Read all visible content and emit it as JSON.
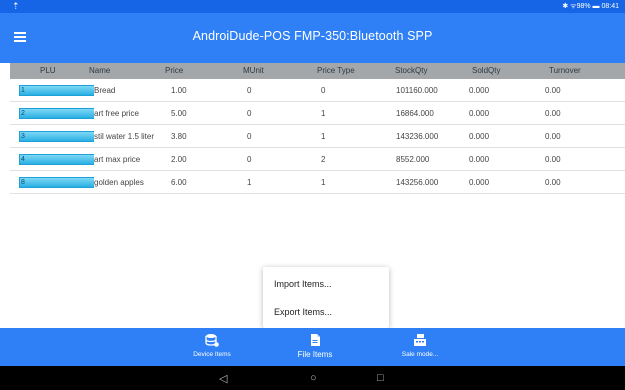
{
  "status": {
    "left_icon": "upload-arrow-icon",
    "right_text": "✱ ᯤ98% ▬ 08:41"
  },
  "app": {
    "title": "AndroiDude-POS   FMP-350:Bluetooth SPP"
  },
  "table": {
    "columns": [
      "PLU",
      "Name",
      "Price",
      "MUnit",
      "Price Type",
      "StockQty",
      "SoldQty",
      "Turnover"
    ],
    "rows": [
      {
        "plu": "1",
        "name": "Bread",
        "price": "1.00",
        "munit": "0",
        "price_type": "0",
        "stock": "101160.000",
        "sold": "0.000",
        "turnover": "0.00"
      },
      {
        "plu": "2",
        "name": "art free price",
        "price": "5.00",
        "munit": "0",
        "price_type": "1",
        "stock": "16864.000",
        "sold": "0.000",
        "turnover": "0.00"
      },
      {
        "plu": "3",
        "name": "stil water 1.5 liter",
        "price": "3.80",
        "munit": "0",
        "price_type": "1",
        "stock": "143236.000",
        "sold": "0.000",
        "turnover": "0.00"
      },
      {
        "plu": "4",
        "name": "art max price",
        "price": "2.00",
        "munit": "0",
        "price_type": "2",
        "stock": "8552.000",
        "sold": "0.000",
        "turnover": "0.00"
      },
      {
        "plu": "8",
        "name": "golden apples",
        "price": "6.00",
        "munit": "1",
        "price_type": "1",
        "stock": "143256.000",
        "sold": "0.000",
        "turnover": "0.00"
      }
    ]
  },
  "popup": {
    "items": [
      "Import Items...",
      "Export Items..."
    ]
  },
  "bottom_nav": {
    "tabs": [
      {
        "label": "Device Items",
        "icon": "database-icon"
      },
      {
        "label": "File Items",
        "icon": "file-icon"
      },
      {
        "label": "Sale mode...",
        "icon": "cash-register-icon"
      }
    ],
    "active_index": 1
  },
  "system_nav": {
    "back": "◁",
    "home": "○",
    "recents": "□"
  },
  "colors": {
    "status_bar": "#1565e6",
    "app_bar": "#2f80f6",
    "header": "#a3a7aa",
    "plu_cell": "#2ab0e3"
  }
}
